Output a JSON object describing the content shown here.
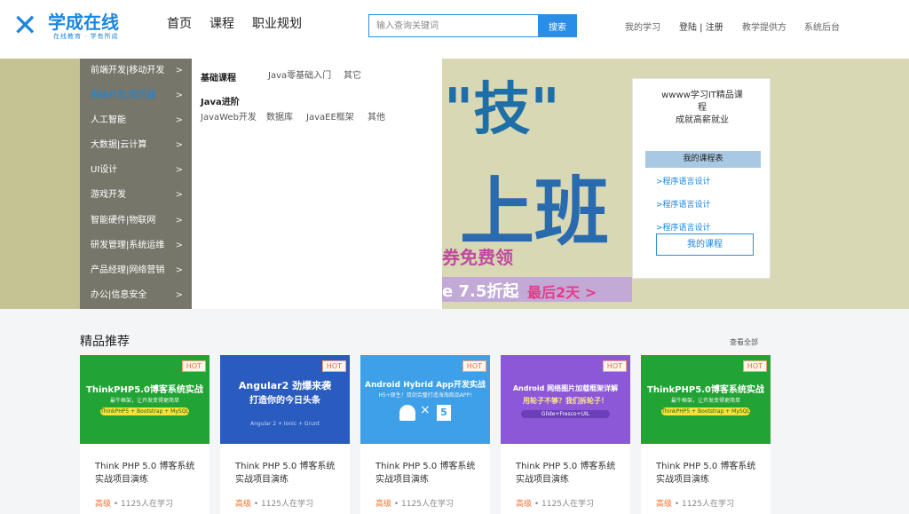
{
  "header": {
    "logo_name": "学成在线",
    "logo_slogan": "在线教育 · 学有所成",
    "nav": [
      "首页",
      "课程",
      "职业规划"
    ],
    "search_placeholder": "输入查询关键词",
    "search_button": "搜索",
    "my_learning": "我的学习",
    "auth": "登陆 | 注册",
    "teacher": "教学提供方",
    "admin": "系统后台"
  },
  "categories": [
    "前端开发|移动开发",
    "后端开发|服务器",
    "人工智能",
    "大数据|云计算",
    "UI设计",
    "游戏开发",
    "智能硬件|物联网",
    "研发管理|系统运维",
    "产品经理|网络营销",
    "办公|信息安全"
  ],
  "submenu": {
    "group1_title": "基础课程",
    "group1_links": [
      "Java零基础入门",
      "其它"
    ],
    "group2_title": "Java进阶",
    "group2_links": [
      "JavaWeb开发",
      "数据库",
      "JavaEE框架",
      "其他"
    ]
  },
  "banner_art": {
    "big1": "\"技\"",
    "big2": "上班",
    "promo": "券免费领",
    "promo2": "e 7.5折起",
    "promo3": "最后2天 >"
  },
  "side_card": {
    "title_line1": "wwww学习IT精品课",
    "title_line2": "程",
    "title_line3": "成就高薪就业",
    "bar": "我的课程表",
    "links": [
      ">程序语言设计",
      ">程序语言设计",
      ">程序语言设计"
    ],
    "button": "我的课程"
  },
  "section": {
    "title": "精品推荐",
    "view_all": "查看全部"
  },
  "cards": [
    {
      "hot": "HOT",
      "img_title": "ThinkPHP5.0博客系统实战",
      "img_sub": "最牛框架，让开发变得更简单",
      "img_pill": "ThinkPHP5 + Bootstrap + MySQL",
      "title": "Think PHP 5.0 博客系统实战项目演练",
      "level": "高级",
      "learners": " • 1125人在学习"
    },
    {
      "hot": "HOT",
      "img_title": "Angular2 劲爆来袭",
      "img_sub": "打造你的今日头条",
      "img_pill": "Angular 2 + Ionic + Grunt",
      "title": "Think PHP 5.0 博客系统实战项目演练",
      "level": "高级",
      "learners": " • 1125人在学习"
    },
    {
      "hot": "HOT",
      "img_title": "Android Hybrid App开发实战",
      "img_sub": "H5+原生！双剑合璧打造海淘商品APP!",
      "img_pill": "",
      "title": "Think PHP 5.0 博客系统实战项目演练",
      "level": "高级",
      "learners": " • 1125人在学习"
    },
    {
      "hot": "HOT",
      "img_title": "Android 网络图片加载框架详解",
      "img_sub": "用轮子不够？我们拆轮子！",
      "img_pill": "Glide+Fresco+UIL",
      "title": "Think PHP 5.0 博客系统实战项目演练",
      "level": "高级",
      "learners": " • 1125人在学习"
    },
    {
      "hot": "HOT",
      "img_title": "ThinkPHP5.0博客系统实战",
      "img_sub": "最牛框架，让开发变得更简单",
      "img_pill": "ThinkPHP5 + Bootstrap + MySQL",
      "title": "Think PHP 5.0 博客系统实战项目演练",
      "level": "高级",
      "learners": " • 1125人在学习"
    }
  ],
  "colors": {
    "brand": "#1a86e0",
    "hot": "#f07030",
    "banner_bg": "#c5c293",
    "category_bg": "#77766a"
  }
}
